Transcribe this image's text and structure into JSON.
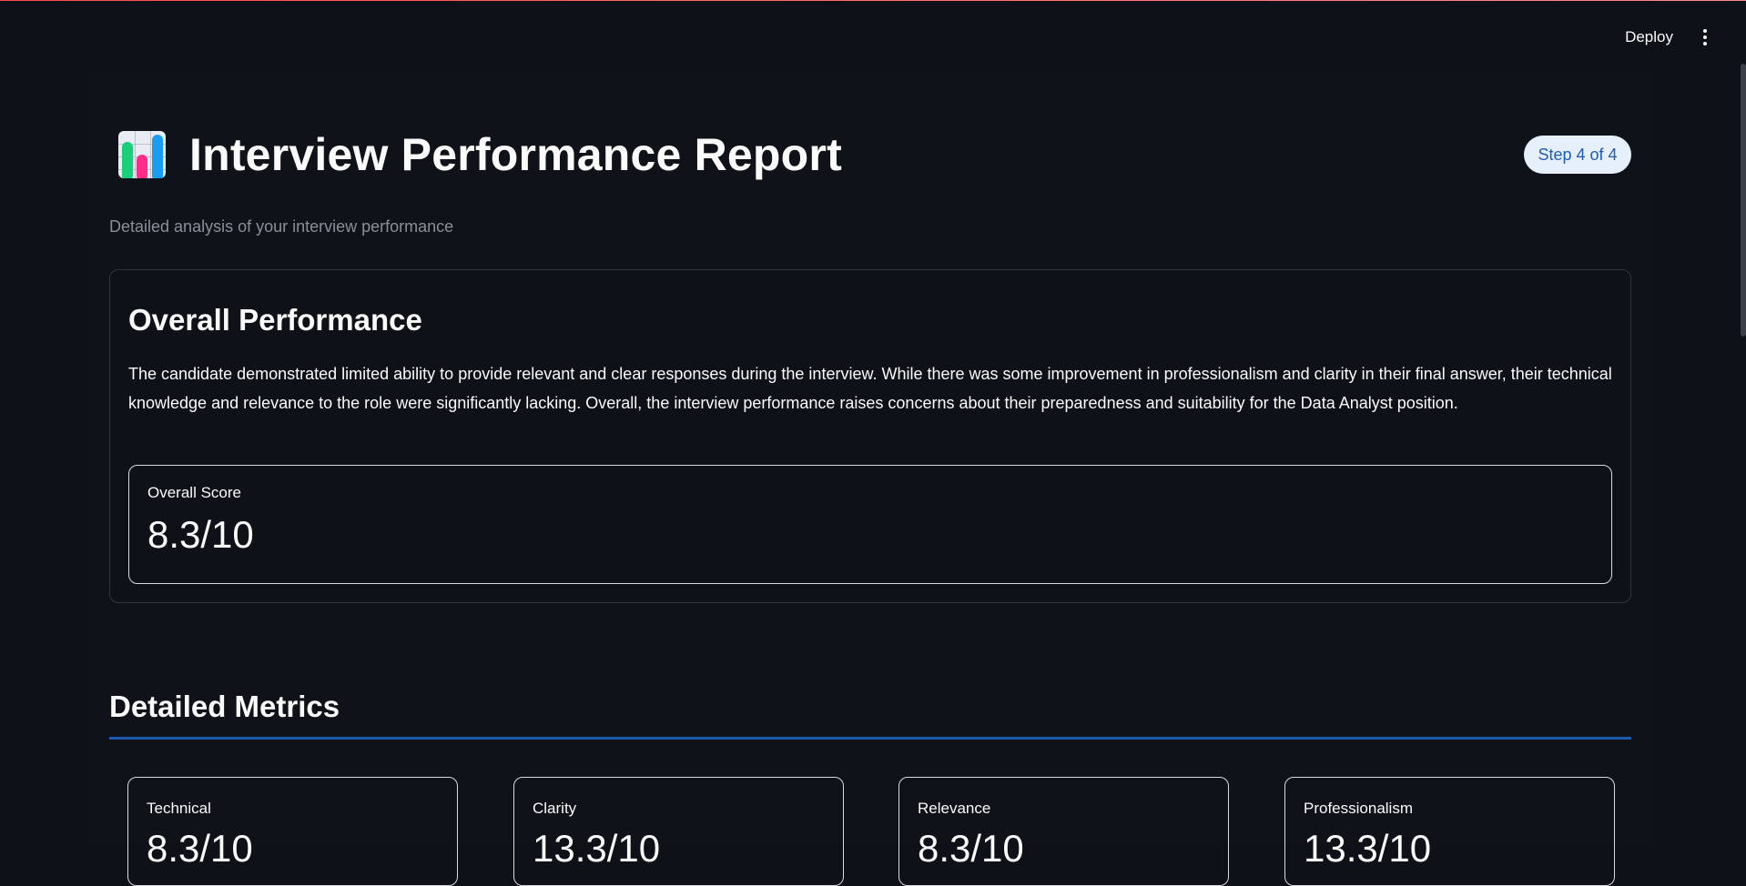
{
  "header": {
    "deploy_label": "Deploy",
    "menu_icon": "kebab-menu-icon"
  },
  "page": {
    "title_icon": "bar-chart-emoji-icon",
    "title": "Interview Performance Report",
    "step_badge": "Step 4 of 4",
    "subtitle": "Detailed analysis of your interview performance"
  },
  "overall": {
    "heading": "Overall Performance",
    "summary": "The candidate demonstrated limited ability to provide relevant and clear responses during the interview. While there was some improvement in professionalism and clarity in their final answer, their technical knowledge and relevance to the role were significantly lacking. Overall, the interview performance raises concerns about their preparedness and suitability for the Data Analyst position.",
    "score_label": "Overall Score",
    "score_value": "8.3/10"
  },
  "metrics": {
    "heading": "Detailed Metrics",
    "items": [
      {
        "label": "Technical",
        "value": "8.3/10"
      },
      {
        "label": "Clarity",
        "value": "13.3/10"
      },
      {
        "label": "Relevance",
        "value": "8.3/10"
      },
      {
        "label": "Professionalism",
        "value": "13.3/10"
      }
    ]
  },
  "colors": {
    "background": "#0e1117",
    "accent_rule": "#1c5bb0",
    "badge_bg": "#e6f0fd",
    "badge_text": "#1e5bb8"
  }
}
